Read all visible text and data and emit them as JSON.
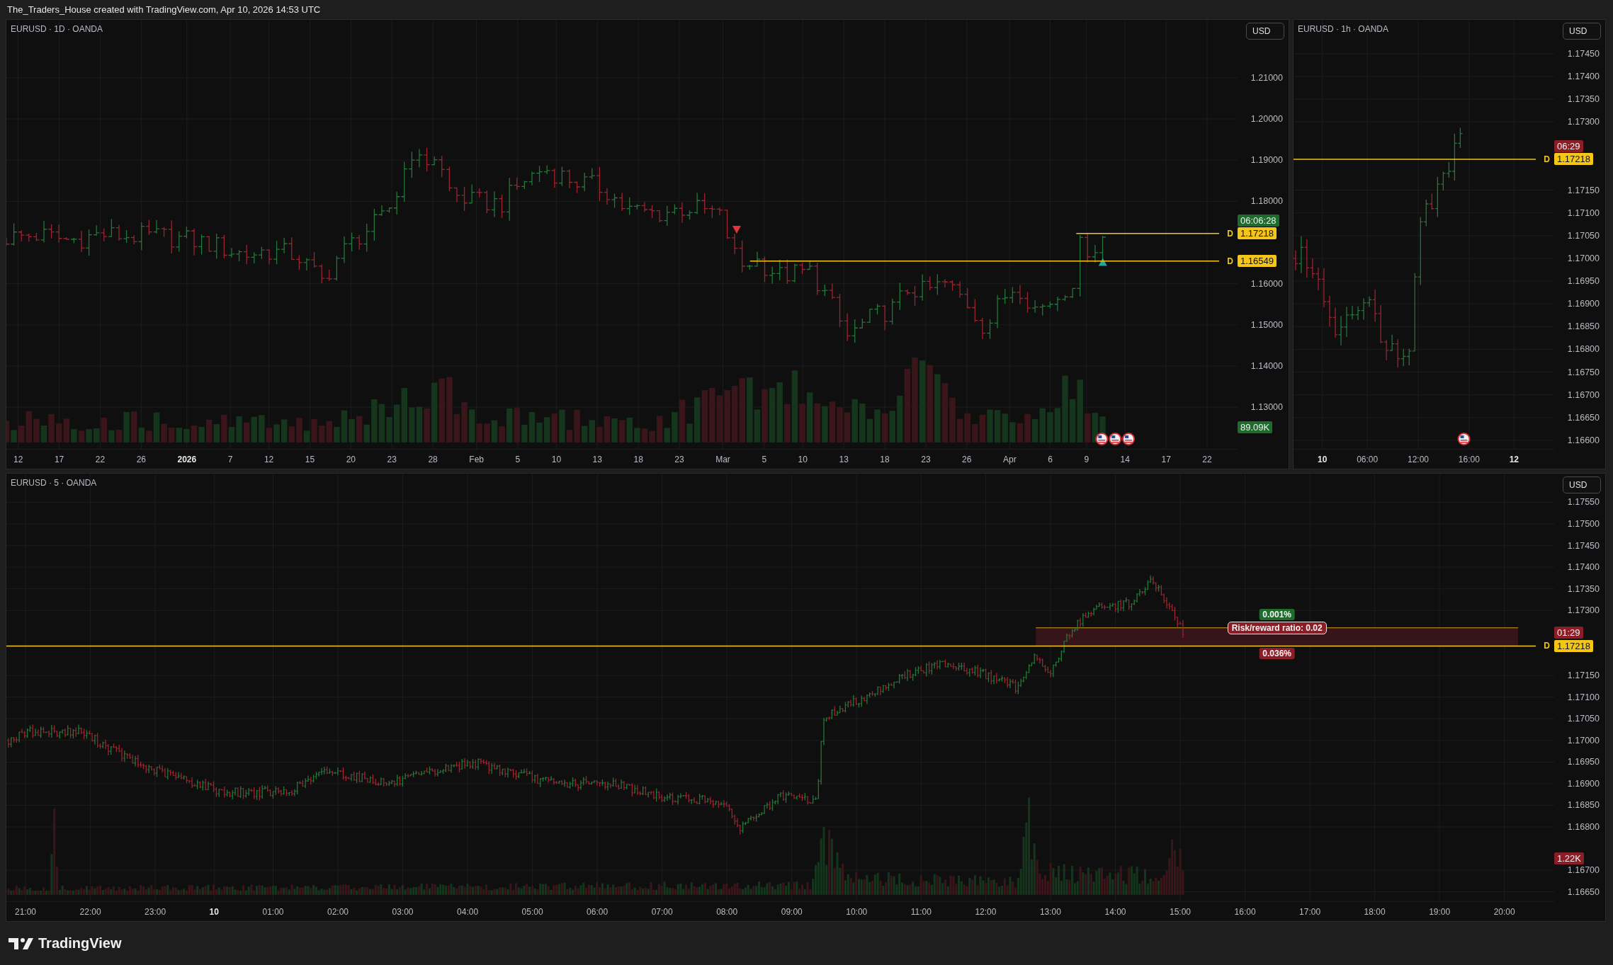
{
  "header": {
    "text": "The_Traders_House created with TradingView.com, Apr 10, 2026 14:53 UTC"
  },
  "panes": [
    {
      "kind": "daily",
      "legend": "EURUSD · 1D · OANDA",
      "currency": "USD",
      "price_ticks": [
        "1.21000",
        "1.20000",
        "1.19000",
        "1.18000",
        "1.16000",
        "1.15000",
        "1.14000",
        "1.13000"
      ],
      "levels": [
        {
          "marker": "D",
          "value": "1.17218",
          "countdown": {
            "text": "06:06:28",
            "color": "#1f6b2e"
          }
        },
        {
          "marker": "D",
          "value": "1.16549"
        }
      ],
      "volume": {
        "text": "89.09K",
        "color": "#1f6b2e"
      },
      "time_ticks": [
        {
          "label": "12",
          "bold": false
        },
        {
          "label": "17",
          "bold": false
        },
        {
          "label": "22",
          "bold": false
        },
        {
          "label": "26",
          "bold": false
        },
        {
          "label": "2026",
          "bold": true
        },
        {
          "label": "7",
          "bold": false
        },
        {
          "label": "12",
          "bold": false
        },
        {
          "label": "15",
          "bold": false
        },
        {
          "label": "20",
          "bold": false
        },
        {
          "label": "23",
          "bold": false
        },
        {
          "label": "28",
          "bold": false
        },
        {
          "label": "Feb",
          "bold": false
        },
        {
          "label": "5",
          "bold": false
        },
        {
          "label": "10",
          "bold": false
        },
        {
          "label": "13",
          "bold": false
        },
        {
          "label": "18",
          "bold": false
        },
        {
          "label": "23",
          "bold": false
        },
        {
          "label": "Mar",
          "bold": false
        },
        {
          "label": "5",
          "bold": false
        },
        {
          "label": "10",
          "bold": false
        },
        {
          "label": "13",
          "bold": false
        },
        {
          "label": "18",
          "bold": false
        },
        {
          "label": "23",
          "bold": false
        },
        {
          "label": "26",
          "bold": false
        },
        {
          "label": "Apr",
          "bold": false
        },
        {
          "label": "6",
          "bold": false
        },
        {
          "label": "9",
          "bold": false
        },
        {
          "label": "14",
          "bold": false
        },
        {
          "label": "17",
          "bold": false
        },
        {
          "label": "22",
          "bold": false
        }
      ]
    },
    {
      "kind": "hourly",
      "legend": "EURUSD · 1h · OANDA",
      "currency": "USD",
      "price_ticks": [
        "1.17450",
        "1.17400",
        "1.17350",
        "1.17300",
        "1.17150",
        "1.17100",
        "1.17050",
        "1.17000",
        "1.16950",
        "1.16900",
        "1.16850",
        "1.16800",
        "1.16750",
        "1.16700",
        "1.16650",
        "1.16600"
      ],
      "levels": [
        {
          "marker": "D",
          "value": "1.17218",
          "countdown": {
            "text": "06:29",
            "color": "#8b1d27"
          }
        }
      ],
      "time_ticks": [
        {
          "label": "10",
          "bold": true
        },
        {
          "label": "06:00",
          "bold": false
        },
        {
          "label": "12:00",
          "bold": false
        },
        {
          "label": "16:00",
          "bold": false
        },
        {
          "label": "12",
          "bold": true
        }
      ]
    },
    {
      "kind": "intraday",
      "legend": "EURUSD · 5 · OANDA",
      "currency": "USD",
      "price_ticks": [
        "1.17550",
        "1.17500",
        "1.17450",
        "1.17400",
        "1.17350",
        "1.17300",
        "1.17150",
        "1.17100",
        "1.17050",
        "1.17000",
        "1.16950",
        "1.16900",
        "1.16850",
        "1.16800",
        "1.16700",
        "1.16650"
      ],
      "levels": [
        {
          "marker": "D",
          "value": "1.17218",
          "countdown": {
            "text": "01:29",
            "color": "#8b1d27"
          }
        }
      ],
      "volume": {
        "text": "1.22K",
        "color": "#8b1d27"
      },
      "position_tool": {
        "target": "0.001%",
        "ratio": "Risk/reward ratio: 0.02",
        "stop": "0.036%"
      },
      "time_ticks": [
        {
          "label": "21:00",
          "bold": false
        },
        {
          "label": "22:00",
          "bold": false
        },
        {
          "label": "23:00",
          "bold": false
        },
        {
          "label": "10",
          "bold": true
        },
        {
          "label": "01:00",
          "bold": false
        },
        {
          "label": "02:00",
          "bold": false
        },
        {
          "label": "03:00",
          "bold": false
        },
        {
          "label": "04:00",
          "bold": false
        },
        {
          "label": "05:00",
          "bold": false
        },
        {
          "label": "06:00",
          "bold": false
        },
        {
          "label": "07:00",
          "bold": false
        },
        {
          "label": "08:00",
          "bold": false
        },
        {
          "label": "09:00",
          "bold": false
        },
        {
          "label": "10:00",
          "bold": false
        },
        {
          "label": "11:00",
          "bold": false
        },
        {
          "label": "12:00",
          "bold": false
        },
        {
          "label": "13:00",
          "bold": false
        },
        {
          "label": "14:00",
          "bold": false
        },
        {
          "label": "15:00",
          "bold": false
        },
        {
          "label": "16:00",
          "bold": false
        },
        {
          "label": "17:00",
          "bold": false
        },
        {
          "label": "18:00",
          "bold": false
        },
        {
          "label": "19:00",
          "bold": false
        },
        {
          "label": "20:00",
          "bold": false
        }
      ]
    }
  ],
  "footer": {
    "brand": "TradingView"
  }
}
